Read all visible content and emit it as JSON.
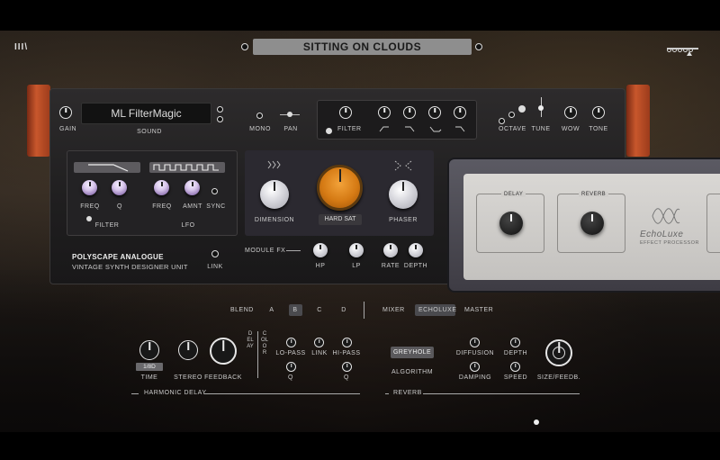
{
  "header": {
    "logo": "III\\",
    "preset_name": "SITTING ON CLOUDS"
  },
  "synth": {
    "name_display": "ML FilterMagic",
    "gain_label": "GAIN",
    "sound_label": "SOUND",
    "mono_label": "MONO",
    "pan_label": "PAN",
    "filter_label": "FILTER",
    "octave_label": "OCTAVE",
    "tune_label": "TUNE",
    "wow_label": "WOW",
    "tone_label": "TONE",
    "filter_section": {
      "freq": "FREQ",
      "q": "Q",
      "title": "FILTER"
    },
    "lfo_section": {
      "freq": "FREQ",
      "amnt": "AMNT",
      "sync": "SYNC",
      "title": "LFO"
    },
    "fx": {
      "dimension": "DIMENSION",
      "hard_sat": "HARD SAT",
      "phaser": "PHASER"
    },
    "brand_line1": "POLYSCAPE ANALOGUE",
    "brand_line2": "VINTAGE SYNTH DESIGNER UNIT",
    "link_label": "LINK",
    "module_fx": {
      "title": "MODULE FX",
      "hp": "HP",
      "lp": "LP",
      "rate": "RATE",
      "depth": "DEPTH"
    }
  },
  "echo": {
    "delay_label": "DELAY",
    "reverb_label": "REVERB",
    "brand": "EchoLuxe",
    "sub": "EFFECT PROCESSOR"
  },
  "tabs": {
    "blend_label": "BLEND",
    "blend_options": [
      "A",
      "B",
      "C",
      "D"
    ],
    "blend_selected": "B",
    "views": [
      "MIXER",
      "ECHOLUXE",
      "MASTER"
    ],
    "view_selected": "ECHOLUXE"
  },
  "delay": {
    "time_value": "1/8D",
    "time": "TIME",
    "stereo": "STEREO",
    "feedback": "FEEDBACK",
    "delay_vertical": "DELAY",
    "color_vertical": "COLOR",
    "lo_pass": "LO-PASS",
    "link": "LINK",
    "hi_pass": "HI-PASS",
    "q1": "Q",
    "q2": "Q",
    "section": "HARMONIC DELAY"
  },
  "reverb": {
    "algorithm_value": "GREYHOLE",
    "algorithm": "ALGORITHM",
    "diffusion": "DIFFUSION",
    "depth": "DEPTH",
    "damping": "DAMPING",
    "speed": "SPEED",
    "size_feedb": "SIZE/FEEDB.",
    "section": "REVERB"
  }
}
